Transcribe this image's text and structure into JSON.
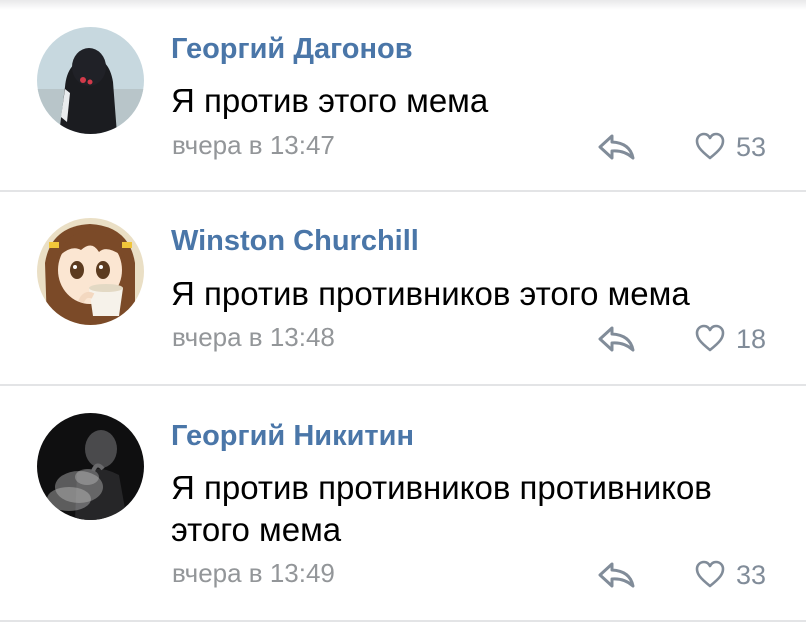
{
  "comments": [
    {
      "author": "Георгий Дагонов",
      "text": "Я против этого мема",
      "time": "вчера в 13:47",
      "likes": "53",
      "avatar_icon": "person-dark-hood-avatar"
    },
    {
      "author": "Winston Churchill",
      "text": "Я против противников этого мема",
      "time": "вчера в 13:48",
      "likes": "18",
      "avatar_icon": "anime-girl-cup-avatar"
    },
    {
      "author": "Георгий Никитин",
      "text": "Я против противников противников этого мема",
      "time": "вчера в 13:49",
      "likes": "33",
      "avatar_icon": "smoking-man-avatar"
    }
  ],
  "icons": {
    "reply": "reply-arrow-icon",
    "like": "heart-outline-icon"
  },
  "colors": {
    "author": "#4a76a8",
    "meta": "#939699",
    "icon": "#818c99",
    "divider": "#e3e4e6"
  }
}
